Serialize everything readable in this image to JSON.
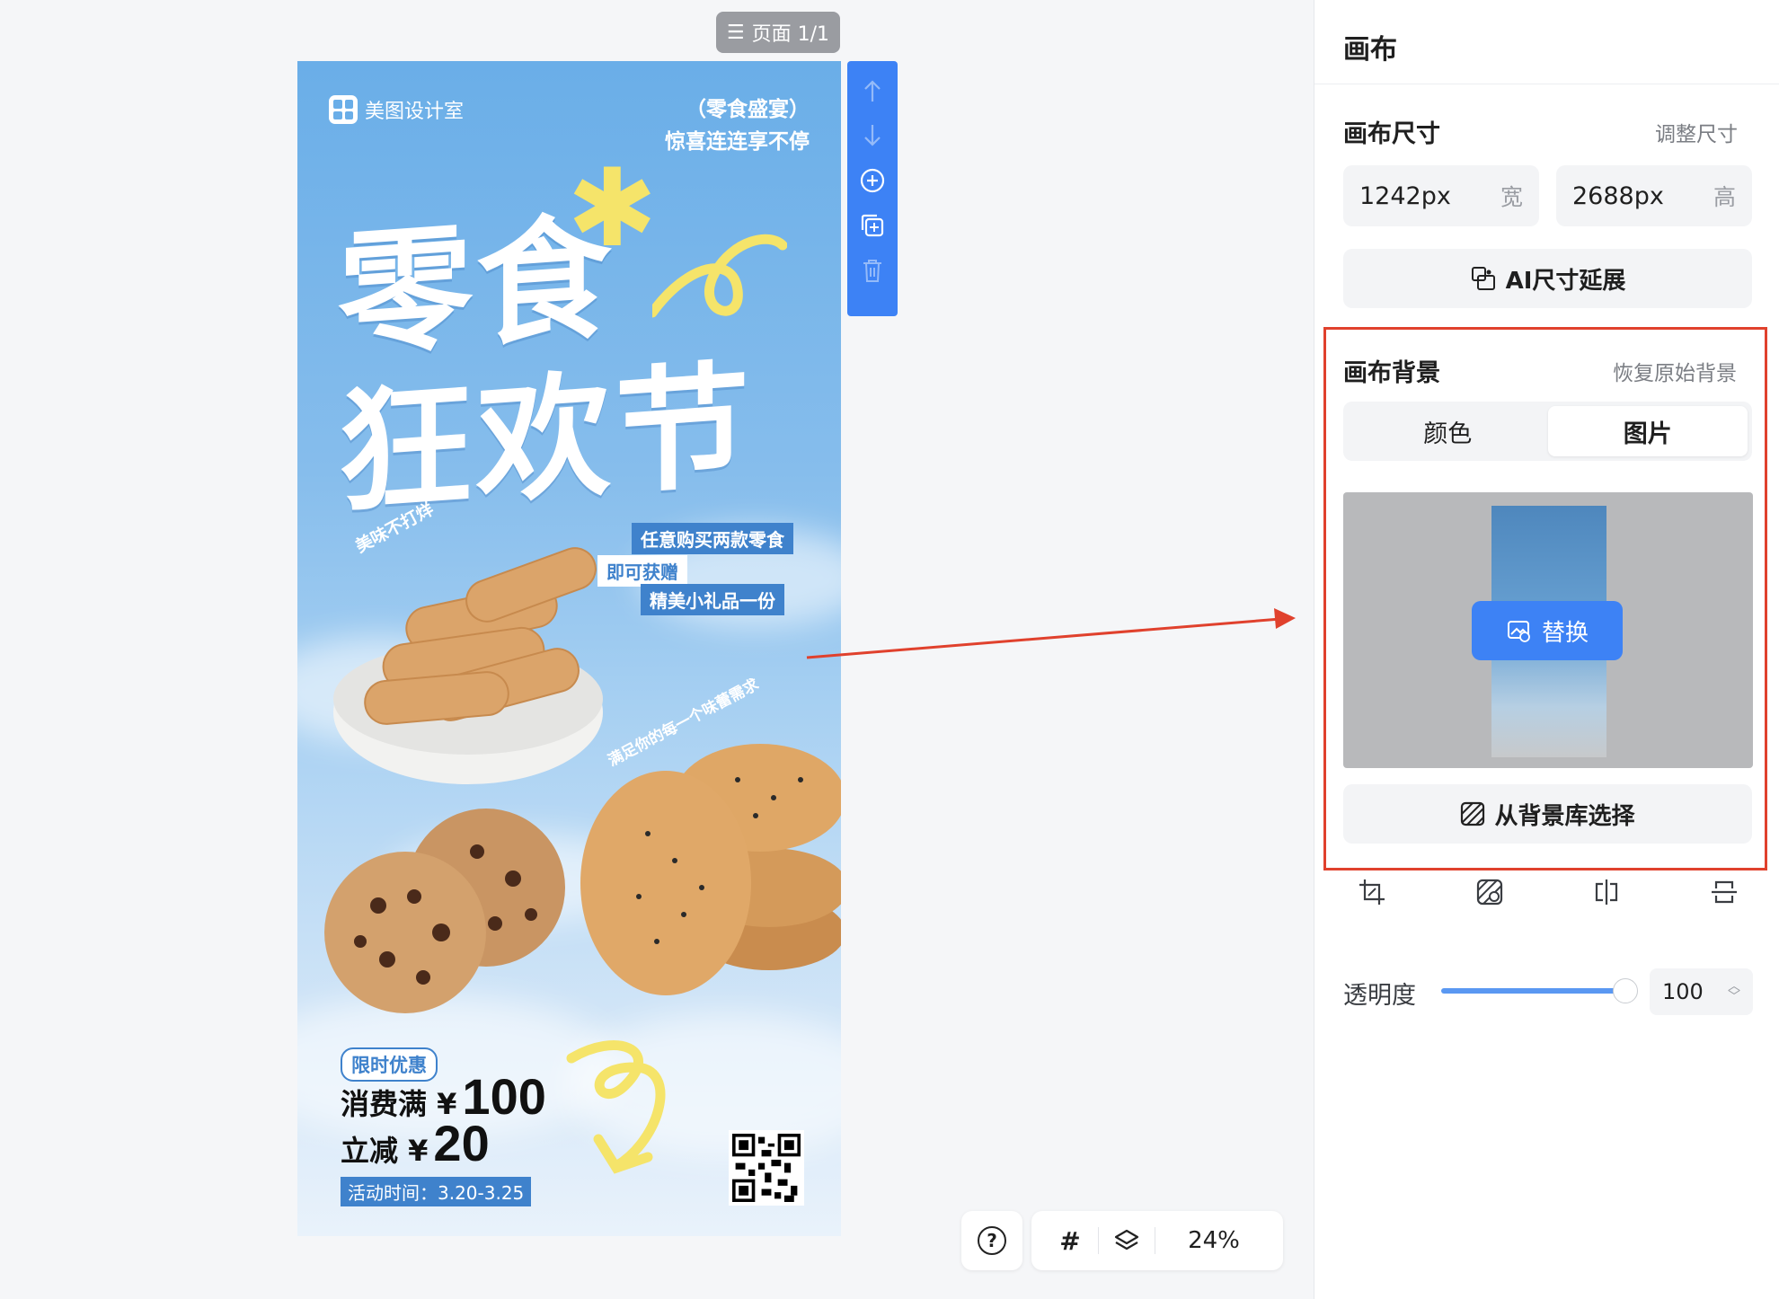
{
  "page_indicator": {
    "icon": "list-icon",
    "label": "页面 1/1"
  },
  "poster": {
    "brand": "美图设计室",
    "top_right_line1": "（零食盛宴）",
    "top_right_line2": "惊喜连连享不停",
    "headline_line1": "零食",
    "headline_line2": "狂欢节",
    "tag1": "任意购买两款零食",
    "tag2": "即可获赠",
    "tag3": "精美小礼品一份",
    "curve1": "美味不打烊",
    "curve2": "满足你的每一个味蕾需求",
    "promo_badge": "限时优惠",
    "promo_l1_prefix": "消费满 ¥",
    "promo_l1_value": "100",
    "promo_l2_prefix": "立减 ¥",
    "promo_l2_value": "20",
    "promo_date": "活动时间：3.20-3.25"
  },
  "vertical_toolbar": [
    {
      "icon": "arrow-up-icon"
    },
    {
      "icon": "arrow-down-icon"
    },
    {
      "icon": "add-page-icon"
    },
    {
      "icon": "duplicate-page-icon"
    },
    {
      "icon": "delete-icon"
    }
  ],
  "bottom_bar": {
    "help_icon": "?",
    "grid_icon": "#",
    "zoom": "24%"
  },
  "panel": {
    "title": "画布",
    "size_label": "画布尺寸",
    "size_link": "调整尺寸",
    "width_value": "1242px",
    "width_unit": "宽",
    "height_value": "2688px",
    "height_unit": "高",
    "ai_extend": "AI尺寸延展",
    "bg_label": "画布背景",
    "bg_link": "恢复原始背景",
    "tab_color": "颜色",
    "tab_image": "图片",
    "replace": "替换",
    "from_library": "从背景库选择",
    "opacity_label": "透明度",
    "opacity_value": "100",
    "opacity_fraction": 1.0
  },
  "colors": {
    "accent": "#3d82f5",
    "highlight": "#e0412d",
    "poster_blue": "#6aaee8"
  }
}
